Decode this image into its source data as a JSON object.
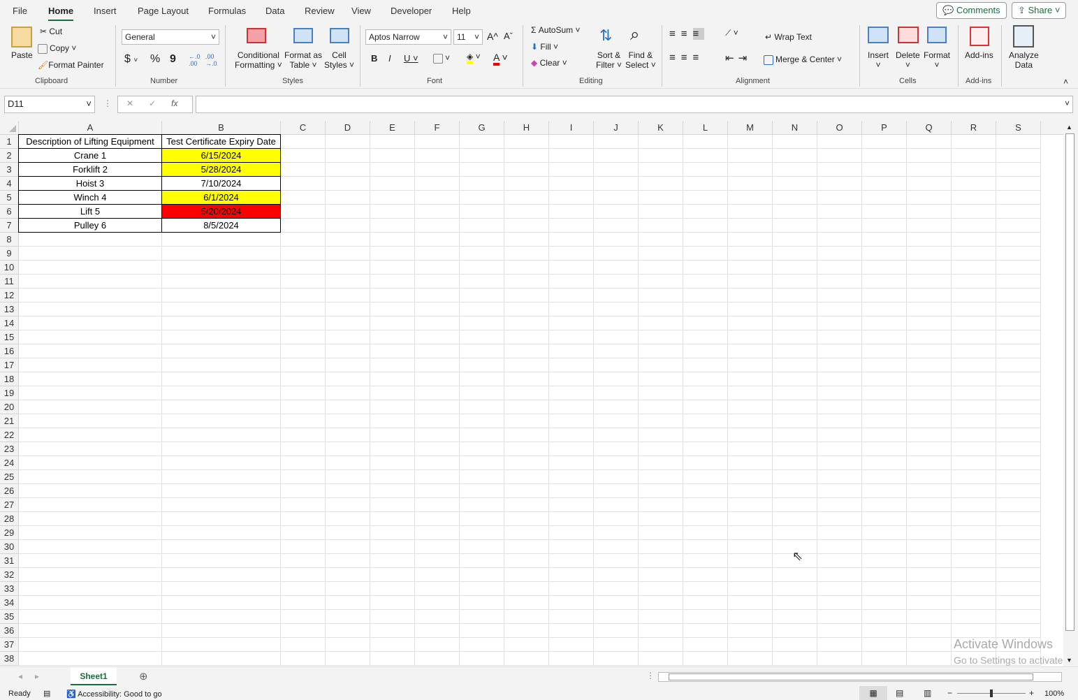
{
  "tabs": [
    "File",
    "Home",
    "Insert",
    "Page Layout",
    "Formulas",
    "Data",
    "Review",
    "View",
    "Developer",
    "Help"
  ],
  "top_buttons": {
    "comments": "Comments",
    "share": "Share"
  },
  "clipboard": {
    "paste": "Paste",
    "cut": "Cut",
    "copy": "Copy",
    "format_painter": "Format Painter",
    "group": "Clipboard"
  },
  "number": {
    "format": "General",
    "currency": "$",
    "percent": "%",
    "comma": "9",
    "inc_decimal": "←.0 .00",
    "dec_decimal": ".00 →.0",
    "group": "Number"
  },
  "styles": {
    "conditional": "Conditional",
    "conditional2": "Formatting",
    "format_table": "Format as",
    "format_table2": "Table",
    "cell_styles": "Cell",
    "cell_styles2": "Styles",
    "group": "Styles"
  },
  "font": {
    "name": "Aptos Narrow",
    "size": "11",
    "bold": "B",
    "italic": "I",
    "underline": "U",
    "grow": "A^",
    "shrink": "Aˇ",
    "group": "Font"
  },
  "editing": {
    "autosum": "AutoSum",
    "fill": "Fill",
    "clear": "Clear",
    "sort": "Sort &",
    "sort2": "Filter",
    "find": "Find &",
    "find2": "Select",
    "group": "Editing"
  },
  "alignment": {
    "wrap": "Wrap Text",
    "merge": "Merge & Center",
    "group": "Alignment"
  },
  "cells": {
    "insert": "Insert",
    "delete": "Delete",
    "format": "Format",
    "group": "Cells"
  },
  "addins": {
    "label": "Add-ins",
    "group": "Add-ins"
  },
  "analyze": {
    "label": "Analyze",
    "label2": "Data"
  },
  "formula_bar": {
    "name_box": "D11",
    "fx": "fx",
    "value": ""
  },
  "columns": [
    "A",
    "B",
    "C",
    "D",
    "E",
    "F",
    "G",
    "H",
    "I",
    "J",
    "K",
    "L",
    "M",
    "N",
    "O",
    "P",
    "Q",
    "R",
    "S"
  ],
  "row_count": 38,
  "table": {
    "headers": [
      "Description of Lifting Equipment",
      "Test Certificate Expiry Date"
    ],
    "rows": [
      {
        "a": "Crane 1",
        "b": "6/15/2024",
        "fill": "#ffff00"
      },
      {
        "a": "Forklift 2",
        "b": "5/28/2024",
        "fill": "#ffff00"
      },
      {
        "a": "Hoist 3",
        "b": "7/10/2024",
        "fill": "#ffffff"
      },
      {
        "a": "Winch 4",
        "b": "6/1/2024",
        "fill": "#ffff00"
      },
      {
        "a": "Lift 5",
        "b": "5/20/2024",
        "fill": "#ff0000"
      },
      {
        "a": "Pulley 6",
        "b": "8/5/2024",
        "fill": "#ffffff"
      }
    ]
  },
  "sheets": [
    "Sheet1"
  ],
  "status": {
    "ready": "Ready",
    "accessibility": "Accessibility: Good to go",
    "zoom": "100%"
  },
  "watermark": {
    "line1": "Activate Windows",
    "line2": "Go to Settings to activate Windows."
  }
}
